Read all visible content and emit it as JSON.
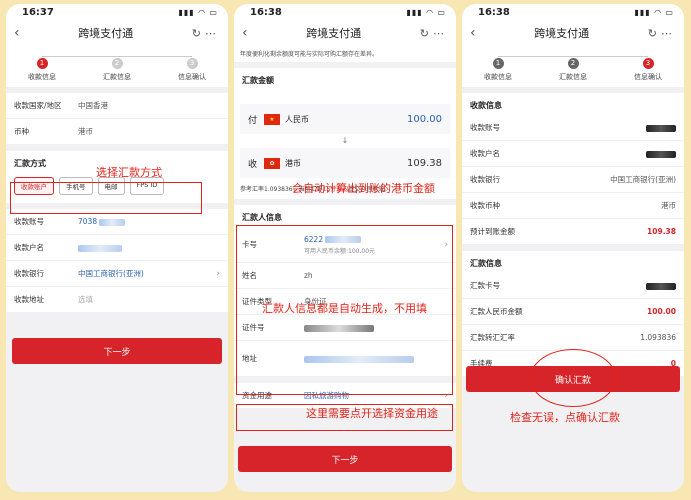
{
  "common": {
    "app_title": "跨境支付通",
    "back_icon": "chevron-left-icon",
    "more_icon": "ellipsis-icon",
    "refresh_icon": "refresh-icon"
  },
  "p1": {
    "time": "16:37",
    "steps": [
      {
        "num": "1",
        "label": "收款信息"
      },
      {
        "num": "2",
        "label": "汇款信息"
      },
      {
        "num": "3",
        "label": "信息确认"
      }
    ],
    "country_label": "收款国家/地区",
    "country_value": "中国香港",
    "currency_label": "币种",
    "currency_value": "港币",
    "method_title": "汇款方式",
    "methods": [
      "收款账户",
      "手机号",
      "电邮",
      "FPS ID"
    ],
    "acct_no_label": "收款账号",
    "acct_no_value": "7038",
    "payee_label": "收款户名",
    "bank_label": "收款银行",
    "bank_value": "中国工商银行(亚洲)",
    "addr_label": "收款地址",
    "addr_placeholder": "选填",
    "next_btn": "下一步",
    "annotation": "选择汇款方式"
  },
  "p2": {
    "time": "16:38",
    "notice": "年度便利化剩余额度可能与实际可购汇额存在差异。",
    "amount_title": "汇款金额",
    "pay_label": "付",
    "pay_currency": "人民币",
    "pay_amount": "100.00",
    "recv_label": "收",
    "recv_currency": "港币",
    "recv_amount": "109.38",
    "rate_text_a": "参考汇率1.093836，当前汇率",
    "rate_text_red": "15分钟内",
    "rate_text_b": "提交办理有效。",
    "remitter_title": "汇款人信息",
    "card_label": "卡号",
    "card_value": "6222",
    "card_sub": "可用人民币余额:100.00元",
    "name_label": "姓名",
    "name_value": "zh",
    "idtype_label": "证件类型",
    "idtype_value": "身份证",
    "idno_label": "证件号",
    "address_label": "地址",
    "purpose_label": "资金用途",
    "purpose_value": "因私旅游购物",
    "next_btn": "下一步",
    "annotation_amount": "会自动计算出到账的港币金额",
    "annotation_info": "汇款人信息都是自动生成，不用填",
    "annotation_purpose": "这里需要点开选择资金用途"
  },
  "p3": {
    "time": "16:38",
    "steps": [
      {
        "num": "1",
        "label": "收款信息"
      },
      {
        "num": "2",
        "label": "汇款信息"
      },
      {
        "num": "3",
        "label": "信息确认"
      }
    ],
    "recv_title": "收款信息",
    "rows_recv": [
      {
        "k": "收款账号",
        "v": ""
      },
      {
        "k": "收款户名",
        "v": ""
      },
      {
        "k": "收款银行",
        "v": "中国工商银行(亚洲)"
      },
      {
        "k": "收款币种",
        "v": "港币"
      },
      {
        "k": "预计到账金额",
        "v": "109.38"
      }
    ],
    "remit_title": "汇款信息",
    "rows_remit": [
      {
        "k": "汇款卡号",
        "v": ""
      },
      {
        "k": "汇款人民币金额",
        "v": "100.00"
      },
      {
        "k": "汇款转汇汇率",
        "v": "1.093836"
      },
      {
        "k": "手续费",
        "v": "0"
      }
    ],
    "confirm_btn": "确认汇款",
    "annotation": "检查无误，点确认汇款"
  }
}
